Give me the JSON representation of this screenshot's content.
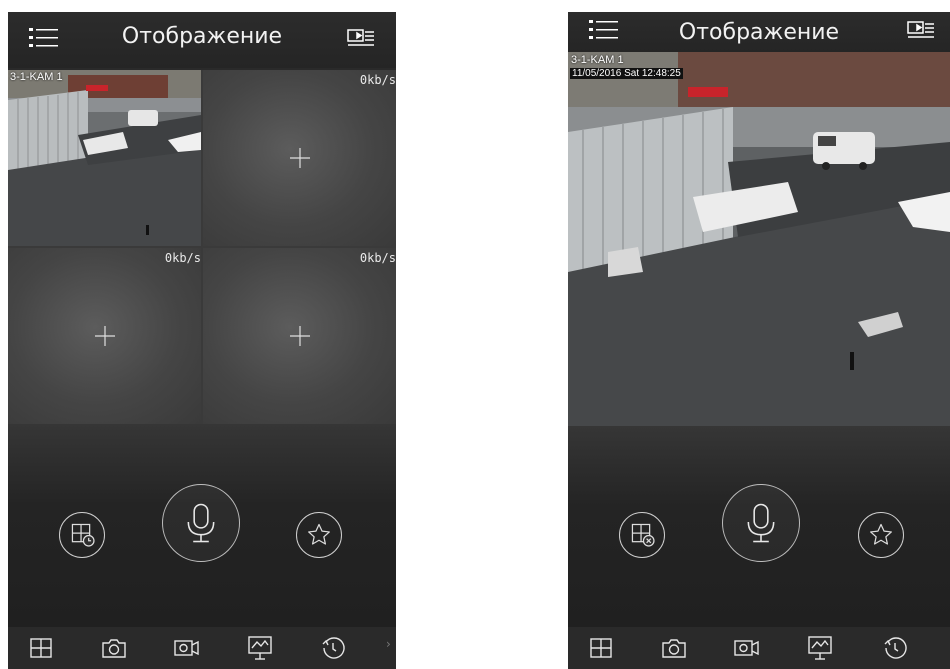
{
  "left_screen": {
    "title": "Отображение",
    "icons": {
      "menu": "menu-list-icon",
      "device": "device-list-icon"
    },
    "channels": [
      {
        "label": "3-1-KAM 1",
        "speed": "",
        "active": true
      },
      {
        "label": "",
        "speed": "0kb/s",
        "active": false
      },
      {
        "label": "",
        "speed": "0kb/s",
        "active": false
      },
      {
        "label": "",
        "speed": "0kb/s",
        "active": false
      }
    ],
    "controls": [
      "playback-grid-icon",
      "microphone-icon",
      "favorite-star-icon"
    ],
    "bottom_nav": [
      "layout-grid-icon",
      "snapshot-camera-icon",
      "record-video-icon",
      "monitor-icon",
      "playback-icon"
    ],
    "more_chevron": "›"
  },
  "right_screen": {
    "title": "Отображение",
    "icons": {
      "menu": "menu-list-icon",
      "device": "device-list-icon"
    },
    "channel_label": "3-1-KAM 1",
    "osd_timestamp": "11/05/2016 Sat 12:48:25",
    "controls": [
      "close-grid-icon",
      "microphone-icon",
      "favorite-star-icon"
    ],
    "bottom_nav": [
      "layout-grid-icon",
      "snapshot-camera-icon",
      "record-video-icon",
      "monitor-icon",
      "playback-icon"
    ]
  },
  "colors": {
    "background": "#2a2a2a",
    "icon_stroke": "#e6e6e6",
    "cell_bg": "#4a4a4a"
  }
}
